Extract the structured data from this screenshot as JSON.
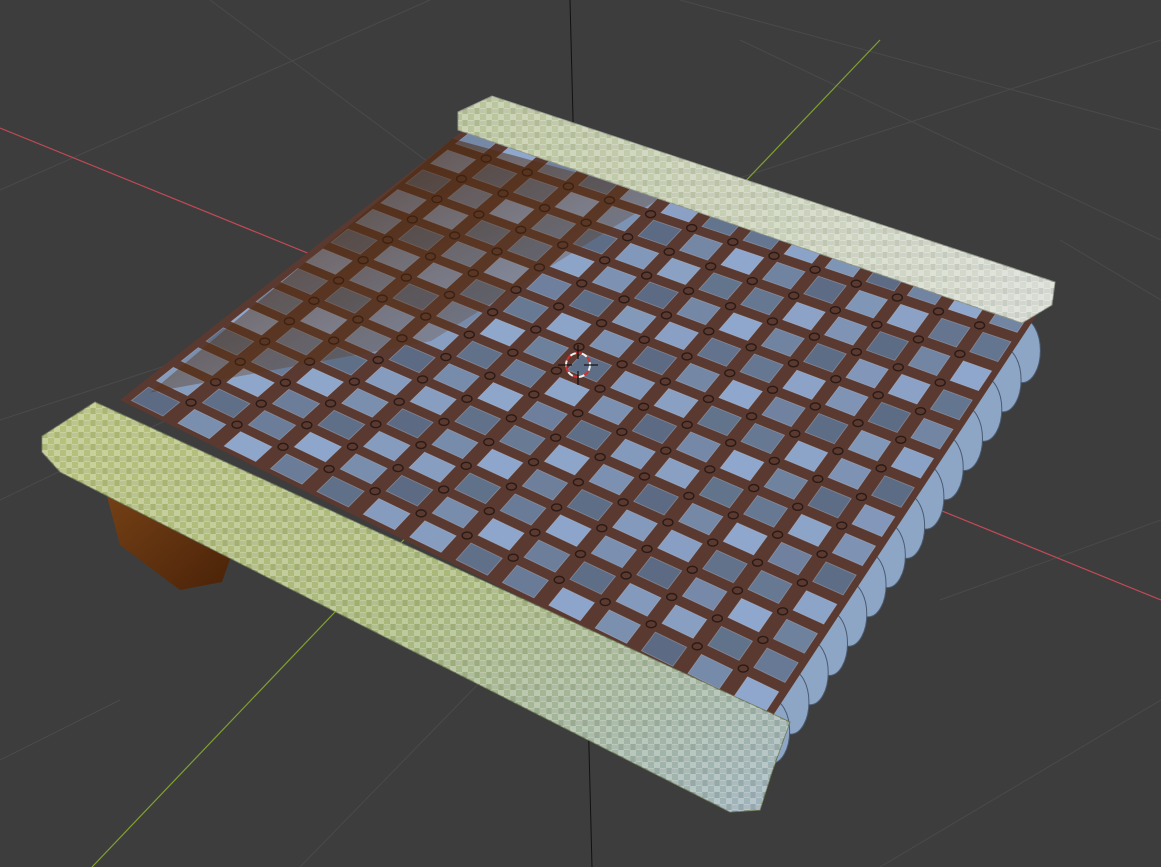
{
  "viewport": {
    "mode": "solid-3d-viewport",
    "background_color": "#3d3d3d",
    "grid_color": "#4a4a4a",
    "x_axis_color": "#c04a56",
    "y_axis_color": "#80a030",
    "z_axis_color": "#111111",
    "cursor_colors": [
      "#d03030",
      "#f0f0f0"
    ]
  },
  "scene_object": {
    "name_icon": "mesh-object",
    "grid_cells": 14,
    "materials": {
      "tile_color": "#8fa7cc",
      "strap_color": "#5a3a30",
      "rail_front_color": "#b8c082",
      "rail_back_color": "#c9cdbf",
      "wood_color": "#6b3a16"
    }
  },
  "icons": {
    "cursor": "3d-cursor-icon",
    "axes": "axis-lines"
  }
}
